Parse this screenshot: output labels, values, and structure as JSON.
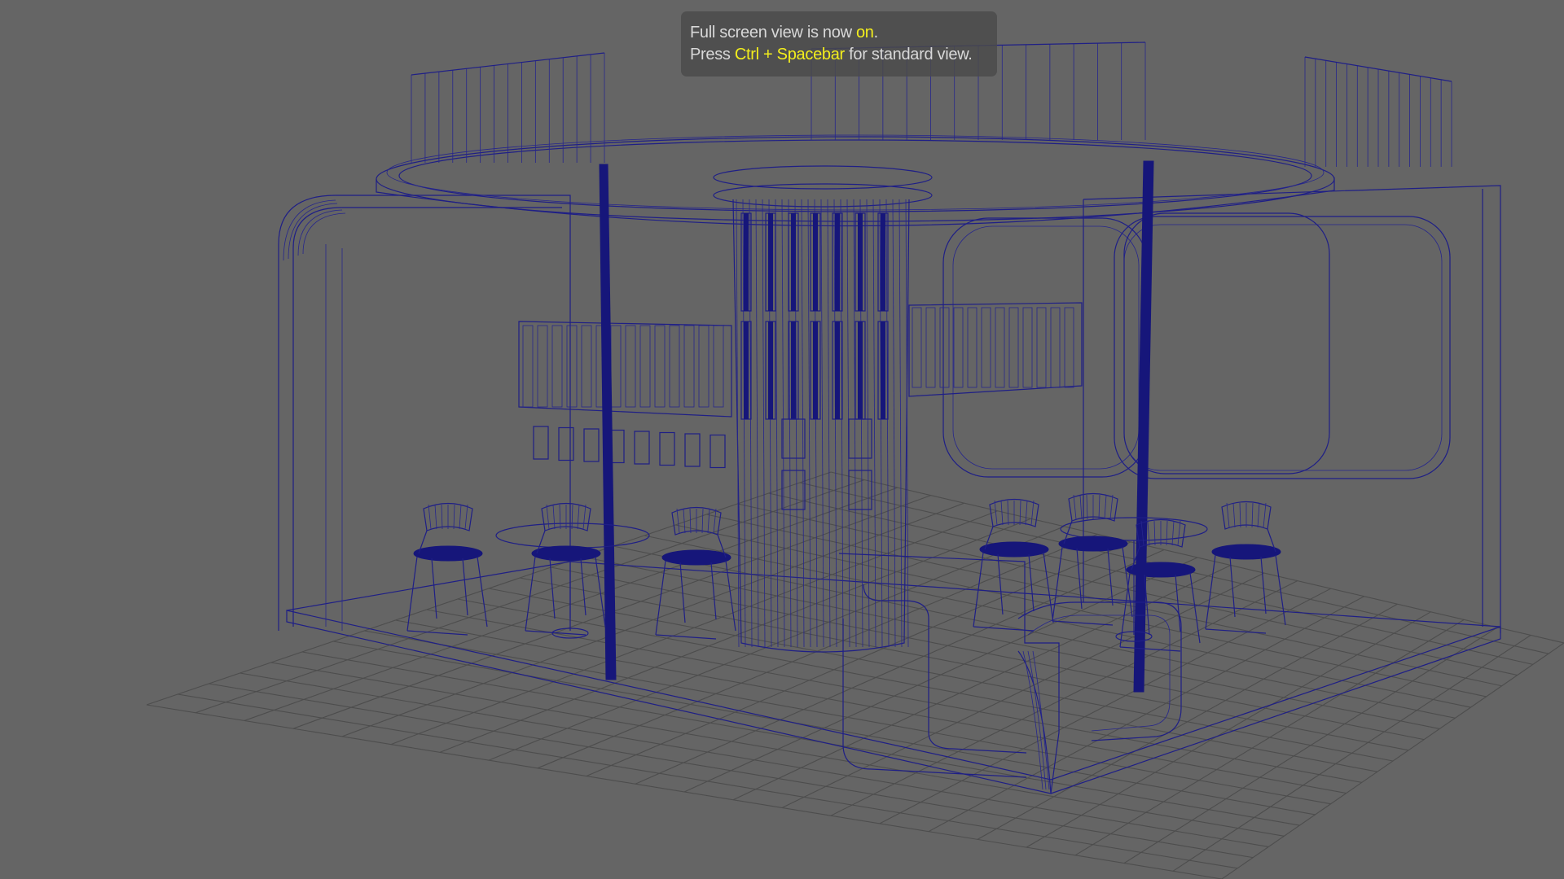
{
  "app": {
    "viewport_label": "Perspective viewport (wireframe)"
  },
  "hud": {
    "line1_prefix": "Full screen view is now ",
    "line1_state": "on",
    "line1_suffix": ".",
    "line2_prefix": "Press ",
    "line2_shortcut": "Ctrl + Spacebar",
    "line2_suffix": " for standard view."
  },
  "colors": {
    "viewport_bg": "#656565",
    "grid_lines": "#4d4d4d",
    "wireframe": "#1f1f86",
    "highlight_text": "#f3ee1c",
    "hud_text": "#d8d8d8"
  },
  "scene": {
    "objects": [
      "booth-walls",
      "canopy-ring",
      "central-column",
      "display-panels",
      "poles",
      "tables",
      "chairs",
      "reception-counter",
      "floor-grid"
    ]
  }
}
